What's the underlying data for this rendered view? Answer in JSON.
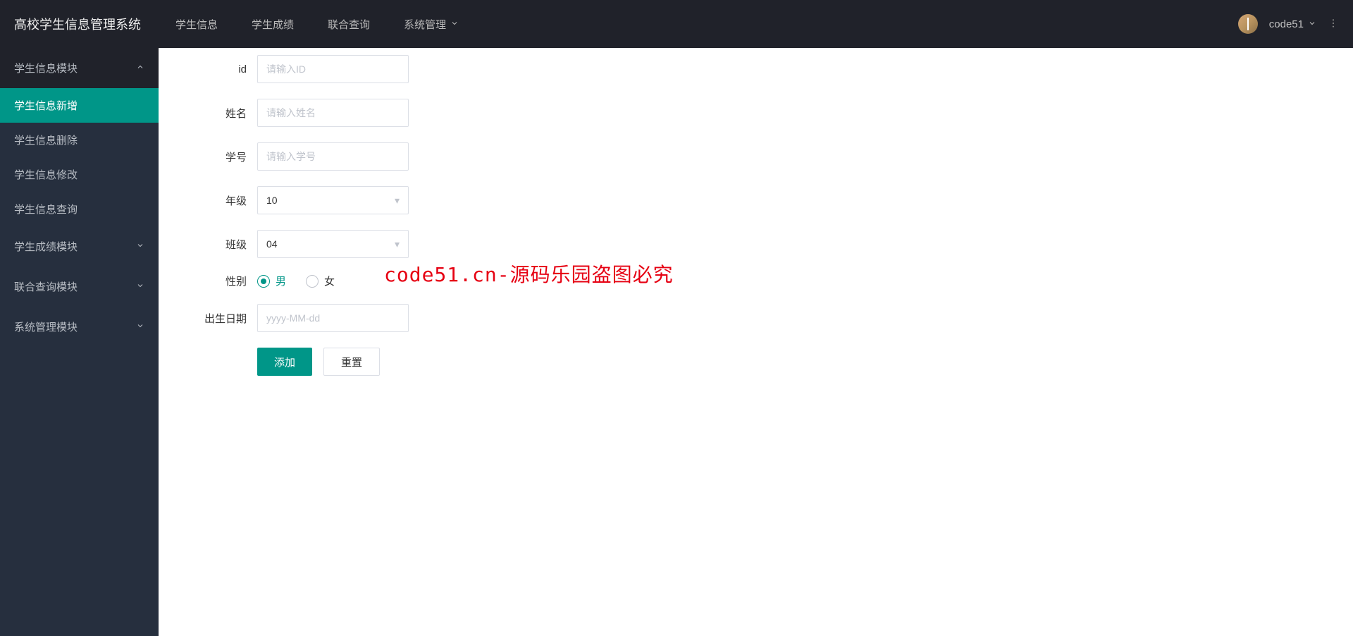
{
  "header": {
    "logo": "高校学生信息管理系统",
    "nav": [
      {
        "label": "学生信息"
      },
      {
        "label": "学生成绩"
      },
      {
        "label": "联合查询"
      },
      {
        "label": "系统管理",
        "dropdown": true
      }
    ],
    "user": {
      "name": "code51"
    }
  },
  "sidebar": {
    "groups": [
      {
        "title": "学生信息模块",
        "expanded": true,
        "items": [
          {
            "label": "学生信息新增",
            "active": true
          },
          {
            "label": "学生信息删除"
          },
          {
            "label": "学生信息修改"
          },
          {
            "label": "学生信息查询"
          }
        ]
      },
      {
        "title": "学生成绩模块",
        "expanded": false
      },
      {
        "title": "联合查询模块",
        "expanded": false
      },
      {
        "title": "系统管理模块",
        "expanded": false
      }
    ]
  },
  "form": {
    "id": {
      "label": "id",
      "placeholder": "请输入ID",
      "value": ""
    },
    "name": {
      "label": "姓名",
      "placeholder": "请输入姓名",
      "value": ""
    },
    "studentNo": {
      "label": "学号",
      "placeholder": "请输入学号",
      "value": ""
    },
    "grade": {
      "label": "年级",
      "value": "10"
    },
    "class": {
      "label": "班级",
      "value": "04"
    },
    "gender": {
      "label": "性别",
      "options": [
        "男",
        "女"
      ],
      "selected": "男"
    },
    "birth": {
      "label": "出生日期",
      "placeholder": "yyyy-MM-dd",
      "value": ""
    },
    "buttons": {
      "add": "添加",
      "reset": "重置"
    }
  },
  "watermark": "code51.cn-源码乐园盗图必究",
  "colors": {
    "accent": "#009688",
    "headerBg": "#20222A",
    "sidebarBg": "#262f3e"
  }
}
